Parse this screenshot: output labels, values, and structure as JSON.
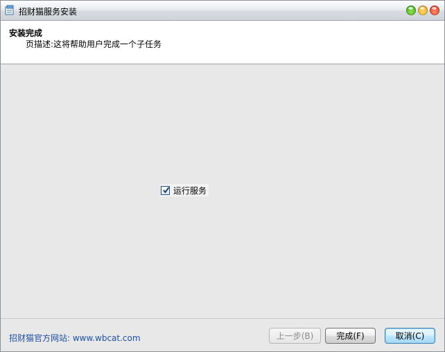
{
  "window": {
    "title": "招财猫服务安装"
  },
  "header": {
    "title": "安装完成",
    "description": "页描述:这将帮助用户完成一个子任务"
  },
  "content": {
    "run_service_checkbox": {
      "label": "运行服务",
      "checked": true
    }
  },
  "footer": {
    "website_text": "招财猫官方网站: www.wbcat.com",
    "back_label": "上一步(B)",
    "finish_label": "完成(F)",
    "cancel_label": "取消(C)"
  },
  "colors": {
    "link": "#1d4fa8",
    "background": "#e8e8e8",
    "header_background": "#ffffff"
  }
}
